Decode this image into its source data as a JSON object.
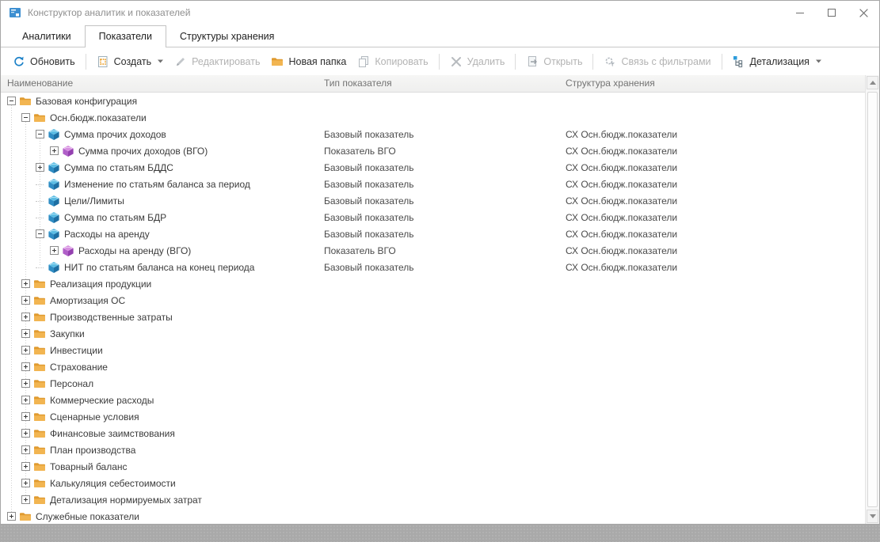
{
  "window": {
    "title": "Конструктор аналитик и показателей",
    "controls": {
      "minimize": "minimize",
      "maximize": "maximize",
      "close": "close"
    }
  },
  "tabs": [
    {
      "id": "analytics",
      "label": "Аналитики",
      "active": false
    },
    {
      "id": "indicators",
      "label": "Показатели",
      "active": true
    },
    {
      "id": "storage-structures",
      "label": "Структуры хранения",
      "active": false
    }
  ],
  "toolbar": [
    {
      "id": "refresh",
      "label": "Обновить",
      "icon": "refresh-icon",
      "enabled": true,
      "dropdown": false,
      "sep_after": true
    },
    {
      "id": "create",
      "label": "Создать",
      "icon": "create-icon",
      "enabled": true,
      "dropdown": true,
      "sep_after": false
    },
    {
      "id": "edit",
      "label": "Редактировать",
      "icon": "edit-icon",
      "enabled": false,
      "dropdown": false,
      "sep_after": false
    },
    {
      "id": "new-folder",
      "label": "Новая папка",
      "icon": "new-folder-icon",
      "enabled": true,
      "dropdown": false,
      "sep_after": false
    },
    {
      "id": "copy",
      "label": "Копировать",
      "icon": "copy-icon",
      "enabled": false,
      "dropdown": false,
      "sep_after": true
    },
    {
      "id": "delete",
      "label": "Удалить",
      "icon": "delete-icon",
      "enabled": false,
      "dropdown": false,
      "sep_after": true
    },
    {
      "id": "open",
      "label": "Открыть",
      "icon": "open-icon",
      "enabled": false,
      "dropdown": false,
      "sep_after": true
    },
    {
      "id": "filter-link",
      "label": "Связь с фильтрами",
      "icon": "filter-link-icon",
      "enabled": false,
      "dropdown": false,
      "sep_after": true
    },
    {
      "id": "detail",
      "label": "Детализация",
      "icon": "detail-icon",
      "enabled": true,
      "dropdown": true,
      "sep_after": false
    }
  ],
  "grid": {
    "columns": [
      "Наименование",
      "Тип показателя",
      "Структура хранения"
    ],
    "rows": [
      {
        "level": 0,
        "expander": "minus",
        "icon": "folder",
        "name": "Базовая конфигурация",
        "type": "",
        "storage": ""
      },
      {
        "level": 1,
        "expander": "minus",
        "icon": "folder",
        "name": "Осн.бюдж.показатели",
        "type": "",
        "storage": ""
      },
      {
        "level": 2,
        "expander": "minus",
        "icon": "cube-blue",
        "name": "Сумма прочих доходов",
        "type": "Базовый показатель",
        "storage": "СХ Осн.бюдж.показатели"
      },
      {
        "level": 3,
        "expander": "plus",
        "icon": "cube-purple",
        "name": "Сумма прочих доходов (ВГО)",
        "type": "Показатель ВГО",
        "storage": "СХ Осн.бюдж.показатели"
      },
      {
        "level": 2,
        "expander": "plus",
        "icon": "cube-blue",
        "name": "Сумма по статьям БДДС",
        "type": "Базовый показатель",
        "storage": "СХ Осн.бюдж.показатели"
      },
      {
        "level": 2,
        "expander": "none",
        "icon": "cube-blue",
        "name": "Изменение по статьям баланса за период",
        "type": "Базовый показатель",
        "storage": "СХ Осн.бюдж.показатели"
      },
      {
        "level": 2,
        "expander": "none",
        "icon": "cube-blue",
        "name": "Цели/Лимиты",
        "type": "Базовый показатель",
        "storage": "СХ Осн.бюдж.показатели"
      },
      {
        "level": 2,
        "expander": "none",
        "icon": "cube-blue",
        "name": "Сумма по статьям БДР",
        "type": "Базовый показатель",
        "storage": "СХ Осн.бюдж.показатели"
      },
      {
        "level": 2,
        "expander": "minus",
        "icon": "cube-blue",
        "name": "Расходы на аренду",
        "type": "Базовый показатель",
        "storage": "СХ Осн.бюдж.показатели"
      },
      {
        "level": 3,
        "expander": "plus",
        "icon": "cube-purple",
        "name": "Расходы на аренду (ВГО)",
        "type": "Показатель ВГО",
        "storage": "СХ Осн.бюдж.показатели"
      },
      {
        "level": 2,
        "expander": "none",
        "icon": "cube-blue",
        "name": "НИТ по статьям баланса на конец периода",
        "type": "Базовый показатель",
        "storage": "СХ Осн.бюдж.показатели"
      },
      {
        "level": 1,
        "expander": "plus",
        "icon": "folder",
        "name": "Реализация продукции",
        "type": "",
        "storage": ""
      },
      {
        "level": 1,
        "expander": "plus",
        "icon": "folder",
        "name": "Амортизация ОС",
        "type": "",
        "storage": ""
      },
      {
        "level": 1,
        "expander": "plus",
        "icon": "folder",
        "name": "Производственные затраты",
        "type": "",
        "storage": ""
      },
      {
        "level": 1,
        "expander": "plus",
        "icon": "folder",
        "name": "Закупки",
        "type": "",
        "storage": ""
      },
      {
        "level": 1,
        "expander": "plus",
        "icon": "folder",
        "name": "Инвестиции",
        "type": "",
        "storage": ""
      },
      {
        "level": 1,
        "expander": "plus",
        "icon": "folder",
        "name": "Страхование",
        "type": "",
        "storage": ""
      },
      {
        "level": 1,
        "expander": "plus",
        "icon": "folder",
        "name": "Персонал",
        "type": "",
        "storage": ""
      },
      {
        "level": 1,
        "expander": "plus",
        "icon": "folder",
        "name": "Коммерческие расходы",
        "type": "",
        "storage": ""
      },
      {
        "level": 1,
        "expander": "plus",
        "icon": "folder",
        "name": "Сценарные условия",
        "type": "",
        "storage": ""
      },
      {
        "level": 1,
        "expander": "plus",
        "icon": "folder",
        "name": "Финансовые заимствования",
        "type": "",
        "storage": ""
      },
      {
        "level": 1,
        "expander": "plus",
        "icon": "folder",
        "name": "План производства",
        "type": "",
        "storage": ""
      },
      {
        "level": 1,
        "expander": "plus",
        "icon": "folder",
        "name": "Товарный баланс",
        "type": "",
        "storage": ""
      },
      {
        "level": 1,
        "expander": "plus",
        "icon": "folder",
        "name": "Калькуляция себестоимости",
        "type": "",
        "storage": ""
      },
      {
        "level": 1,
        "expander": "plus",
        "icon": "folder",
        "name": "Детализация нормируемых затрат",
        "type": "",
        "storage": ""
      },
      {
        "level": 0,
        "expander": "plus",
        "icon": "folder",
        "name": "Служебные показатели",
        "type": "",
        "storage": ""
      }
    ]
  },
  "colors": {
    "accent_blue": "#1e82c8",
    "folder_orange": "#eda83f",
    "cube_blue_top": "#5bbde4",
    "cube_blue_left": "#2f8dc4",
    "cube_blue_right": "#1d6fa3",
    "cube_purple_top": "#d68fe0",
    "cube_purple_left": "#b05fc8",
    "cube_purple_right": "#9440b0",
    "disabled_gray": "#b3b3b3"
  }
}
